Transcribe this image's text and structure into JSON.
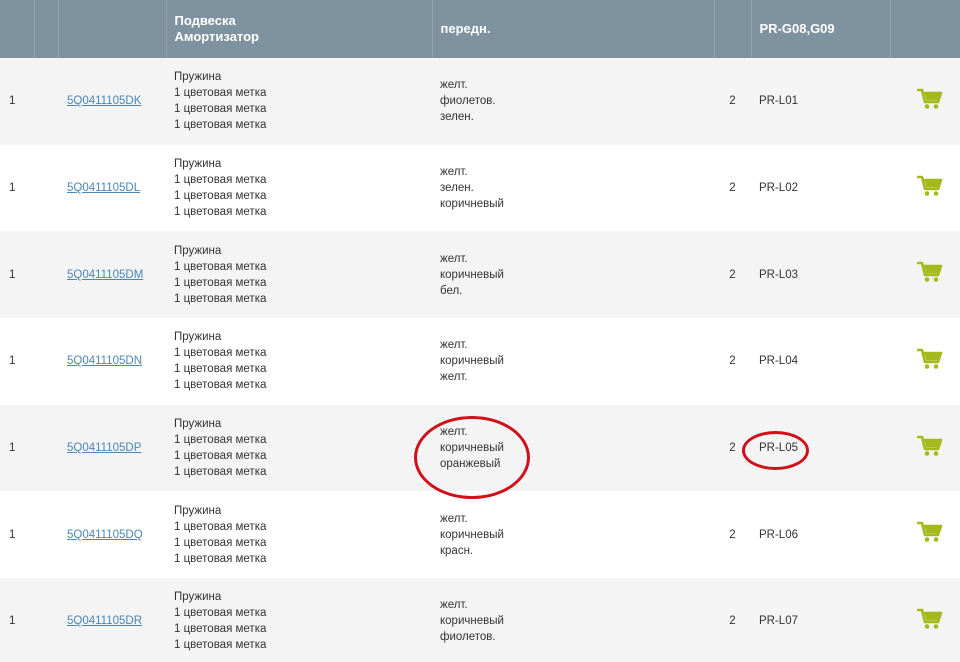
{
  "header": {
    "col0": "",
    "col1": "",
    "col2": "",
    "col3_line1": "Подвеска",
    "col3_line2": "Амортизатор",
    "col4": "передн.",
    "col5": "",
    "col6": "PR-G08,G09",
    "col7": ""
  },
  "rows": [
    {
      "num": "1",
      "part": "5Q0411105DK",
      "desc": [
        "Пружина",
        "1 цветовая метка",
        "1 цветовая метка",
        "1 цветовая метка"
      ],
      "colors": [
        "желт.",
        "фиолетов.",
        "зелен."
      ],
      "qty": "2",
      "pr": "PR-L01"
    },
    {
      "num": "1",
      "part": "5Q0411105DL",
      "desc": [
        "Пружина",
        "1 цветовая метка",
        "1 цветовая метка",
        "1 цветовая метка"
      ],
      "colors": [
        "желт.",
        "зелен.",
        "коричневый"
      ],
      "qty": "2",
      "pr": "PR-L02"
    },
    {
      "num": "1",
      "part": "5Q0411105DM",
      "desc": [
        "Пружина",
        "1 цветовая метка",
        "1 цветовая метка",
        "1 цветовая метка"
      ],
      "colors": [
        "желт.",
        "коричневый",
        "бел."
      ],
      "qty": "2",
      "pr": "PR-L03"
    },
    {
      "num": "1",
      "part": "5Q0411105DN",
      "desc": [
        "Пружина",
        "1 цветовая метка",
        "1 цветовая метка",
        "1 цветовая метка"
      ],
      "colors": [
        "желт.",
        "коричневый",
        "желт."
      ],
      "qty": "2",
      "pr": "PR-L04"
    },
    {
      "num": "1",
      "part": "5Q0411105DP",
      "desc": [
        "Пружина",
        "1 цветовая метка",
        "1 цветовая метка",
        "1 цветовая метка"
      ],
      "colors": [
        "желт.",
        "коричневый",
        "оранжевый"
      ],
      "qty": "2",
      "pr": "PR-L05"
    },
    {
      "num": "1",
      "part": "5Q0411105DQ",
      "desc": [
        "Пружина",
        "1 цветовая метка",
        "1 цветовая метка",
        "1 цветовая метка"
      ],
      "colors": [
        "желт.",
        "коричневый",
        "красн."
      ],
      "qty": "2",
      "pr": "PR-L06"
    },
    {
      "num": "1",
      "part": "5Q0411105DR",
      "desc": [
        "Пружина",
        "1 цветовая метка",
        "1 цветовая метка",
        "1 цветовая метка"
      ],
      "colors": [
        "желт.",
        "коричневый",
        "фиолетов."
      ],
      "qty": "2",
      "pr": "PR-L07"
    }
  ],
  "icons": {
    "cart": "shopping-cart-icon"
  },
  "colors": {
    "header_bg": "#7f92a0",
    "link": "#4a86b6",
    "cart": "#a5b81c",
    "annotation": "#d0101a",
    "row_alt": "#f4f4f4"
  }
}
